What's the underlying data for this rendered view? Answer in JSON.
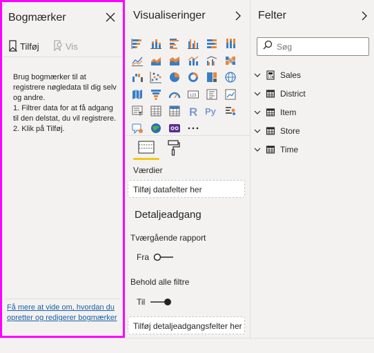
{
  "bookmarks": {
    "title": "Bogmærker",
    "add_label": "Tilføj",
    "view_label": "Vis",
    "help_text": "Brug bogmærker til at registrere nøgledata til dig selv og andre.\n1. Filtrer data for at få adgang til den delstat, du vil registrere.\n2. Klik på Tilføj.",
    "link_text": "Få mere at vide om, hvordan du opretter og redigerer bogmærker"
  },
  "visualizations": {
    "title": "Visualiseringer",
    "icons": [
      "stacked-bar-icon",
      "stacked-column-icon",
      "clustered-bar-icon",
      "clustered-column-icon",
      "100pct-bar-icon",
      "100pct-column-icon",
      "line-chart-icon",
      "area-chart-icon",
      "stacked-area-icon",
      "line-column-icon",
      "line-clustered-column-icon",
      "ribbon-chart-icon",
      "waterfall-icon",
      "scatter-icon",
      "pie-icon",
      "donut-icon",
      "treemap-icon",
      "map-icon",
      "filled-map-icon",
      "funnel-icon",
      "gauge-icon",
      "card-icon",
      "multirow-card-icon",
      "kpi-icon",
      "slicer-icon",
      "table-icon",
      "matrix-icon",
      "r-visual-icon",
      "python-visual-icon",
      "key-influencers-icon",
      "qa-icon",
      "arcgis-icon",
      "custom-visual-icon",
      "more-icon"
    ],
    "values_label": "Værdier",
    "values_placeholder": "Tilføj datafelter her",
    "drill_title": "Detaljeadgang",
    "cross_report_label": "Tværgående rapport",
    "cross_report_state": "Fra",
    "keep_filters_label": "Behold alle filtre",
    "keep_filters_state": "Til",
    "drill_placeholder": "Tilføj detaljeadgangsfelter her"
  },
  "fields": {
    "title": "Felter",
    "search_placeholder": "Søg",
    "tables": [
      {
        "name": "Sales",
        "icon": "calculator-icon"
      },
      {
        "name": "District",
        "icon": "table-icon"
      },
      {
        "name": "Item",
        "icon": "table-icon"
      },
      {
        "name": "Store",
        "icon": "table-icon"
      },
      {
        "name": "Time",
        "icon": "table-icon"
      }
    ]
  },
  "colors": {
    "highlight_border": "#ff00ff",
    "accent_yellow": "#f2c811",
    "link": "#1a5fa6",
    "viz_blue": "#3b7dc4",
    "viz_orange": "#e8873a"
  }
}
